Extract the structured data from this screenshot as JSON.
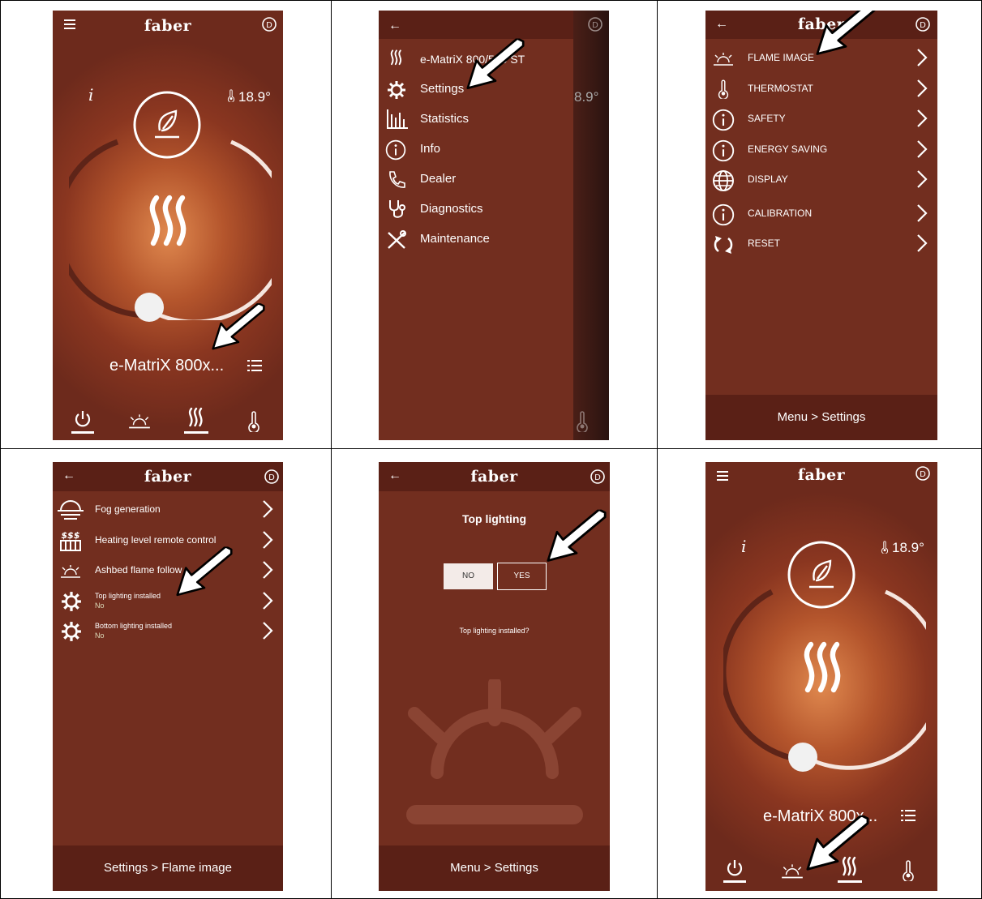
{
  "brand": "faber",
  "temperature": "18.9°",
  "device_name": "e-MatriX 800x...",
  "info_symbol": "i",
  "nav_menu": {
    "device_title": "e-MatriX 800/500 ST",
    "items": [
      {
        "label": "Settings",
        "icon": "gear-icon"
      },
      {
        "label": "Statistics",
        "icon": "bar-chart-icon"
      },
      {
        "label": "Info",
        "icon": "info-icon"
      },
      {
        "label": "Dealer",
        "icon": "phone-icon"
      },
      {
        "label": "Diagnostics",
        "icon": "stethoscope-icon"
      },
      {
        "label": "Maintenance",
        "icon": "tools-icon"
      }
    ]
  },
  "settings": {
    "items": [
      {
        "label": "FLAME IMAGE",
        "icon": "flame-image-icon"
      },
      {
        "label": "THERMOSTAT",
        "icon": "thermostat-icon"
      },
      {
        "label": "SAFETY",
        "icon": "info-icon"
      },
      {
        "label": "ENERGY SAVING",
        "icon": "info-icon"
      },
      {
        "label": "DISPLAY",
        "icon": "globe-icon"
      },
      {
        "label": "CALIBRATION",
        "icon": "info-icon"
      },
      {
        "label": "RESET",
        "icon": "reset-icon"
      }
    ],
    "breadcrumb": "Menu > Settings"
  },
  "flame_image": {
    "items": [
      {
        "label": "Fog generation",
        "sub": "",
        "icon": "fog-icon"
      },
      {
        "label": "Heating level remote control",
        "sub": "",
        "icon": "heater-icon"
      },
      {
        "label": "Ashbed flame follow",
        "sub": "",
        "icon": "flame-image-icon"
      },
      {
        "label": "Top lighting installed",
        "sub": "No",
        "icon": "gear-icon"
      },
      {
        "label": "Bottom lighting installed",
        "sub": "No",
        "icon": "gear-icon"
      }
    ],
    "breadcrumb": "Settings > Flame image"
  },
  "top_lighting": {
    "title": "Top lighting",
    "no_label": "NO",
    "yes_label": "YES",
    "question": "Top lighting installed?",
    "breadcrumb": "Menu > Settings"
  },
  "colors": {
    "dark_bar": "#5a2016",
    "panel": "#722e1f",
    "accent_white": "#ffffff"
  }
}
